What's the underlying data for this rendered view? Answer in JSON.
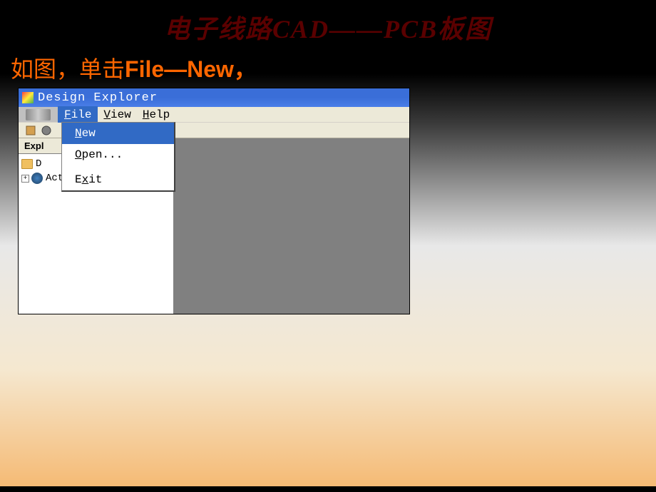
{
  "slide": {
    "title": "电子线路CAD——PCB板图",
    "instruction_prefix": "如图，单击",
    "instruction_bold": "File—New，"
  },
  "window": {
    "title": "Design Explorer"
  },
  "menubar": {
    "file": {
      "prefix": "F",
      "rest": "ile"
    },
    "view": {
      "prefix": "V",
      "rest": "iew"
    },
    "help": {
      "prefix": "H",
      "rest": "elp"
    }
  },
  "dropdown": {
    "new": {
      "prefix": "N",
      "rest": "ew"
    },
    "open": {
      "prefix": "O",
      "rest": "pen..."
    },
    "exit": {
      "pre": "E",
      "u": "x",
      "post": "it"
    }
  },
  "explorer": {
    "tab_label": "Expl",
    "tree": {
      "item1": "D",
      "item2": "Active Design St"
    }
  }
}
